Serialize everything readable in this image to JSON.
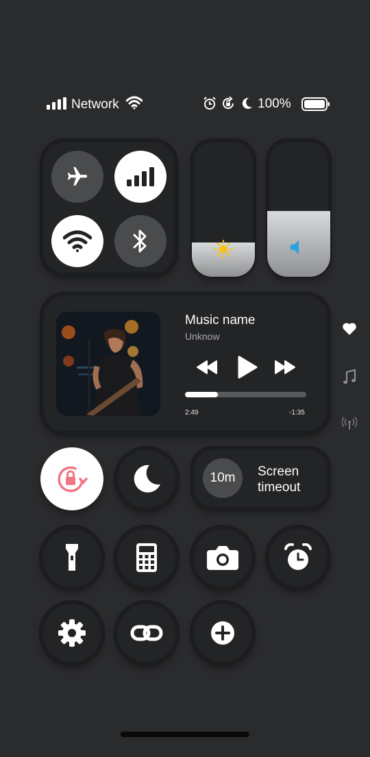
{
  "status_bar": {
    "network_label": "Network",
    "battery_percent": "100%",
    "signal_icon": "signal-bars-icon",
    "wifi_icon": "wifi-icon",
    "alarm_icon": "alarm-icon",
    "rotation_lock_icon": "rotation-lock-icon",
    "dnd_icon": "moon-icon",
    "battery_icon": "battery-icon",
    "battery_level": 1.0
  },
  "connectivity": {
    "airplane": {
      "icon": "airplane-icon",
      "active": false
    },
    "cellular": {
      "icon": "cellular-icon",
      "active": true
    },
    "wifi": {
      "icon": "wifi-icon",
      "active": true
    },
    "bluetooth": {
      "icon": "bluetooth-icon",
      "active": false
    }
  },
  "brightness": {
    "icon": "sun-icon",
    "level": 0.25
  },
  "volume": {
    "icon": "speaker-icon",
    "level": 0.48
  },
  "music": {
    "title": "Music name",
    "artist": "Unknow",
    "elapsed": "2:49",
    "remaining": "-1:35",
    "progress": 0.27
  },
  "side_icons": [
    "heart-icon",
    "music-note-icon",
    "broadcast-icon"
  ],
  "screen_timeout": {
    "value": "10m",
    "label": "Screen timeout"
  },
  "colors": {
    "background": "#2a2b2d",
    "rotation_lock_accent": "#f07585",
    "volume_accent": "#29a3e0",
    "sun_accent": "#f6c21a"
  }
}
